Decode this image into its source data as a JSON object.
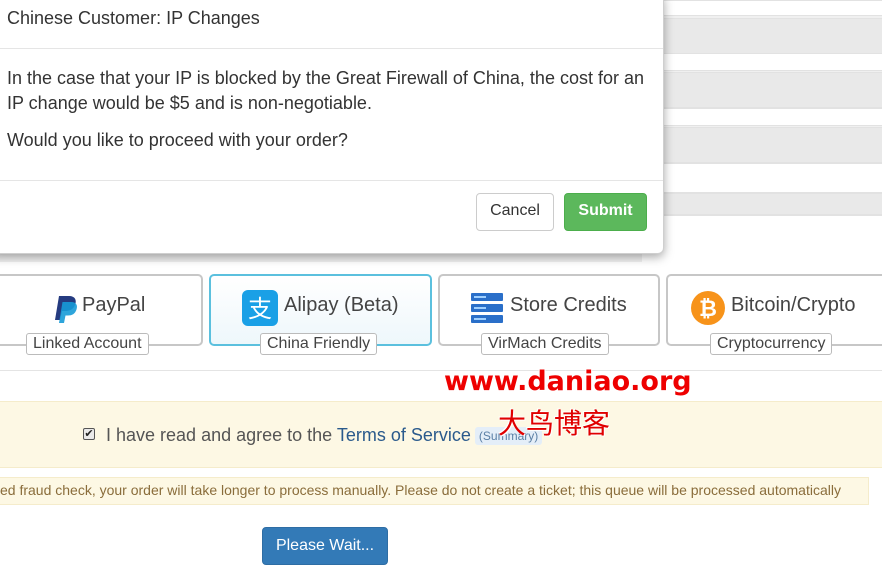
{
  "modal": {
    "title": "Chinese Customer: IP Changes",
    "body_paragraph_1": "In the case that your IP is blocked by the Great Firewall of China, the cost for an IP change would be $5 and is non-negotiable.",
    "body_paragraph_2": "Would you like to proceed with your order?",
    "cancel_label": "Cancel",
    "submit_label": "Submit"
  },
  "payment_methods": [
    {
      "name": "PayPal",
      "tag": "Linked Account",
      "icon": "paypal-icon",
      "selected": false
    },
    {
      "name": "Alipay (Beta)",
      "tag": "China Friendly",
      "icon": "alipay-icon",
      "selected": true
    },
    {
      "name": "Store Credits",
      "tag": "VirMach Credits",
      "icon": "store-credits-icon",
      "selected": false
    },
    {
      "name": "Bitcoin/Crypto",
      "tag": "Cryptocurrency",
      "icon": "bitcoin-icon",
      "selected": false
    }
  ],
  "agreement": {
    "checked": true,
    "text": "I have read and agree to the ",
    "link_text": "Terms of Service",
    "summary_label": "(Summary)"
  },
  "notice": {
    "text": "ed fraud check, your order will take longer to process manually. Please do not create a ticket; this queue will be processed automatically"
  },
  "submit_area": {
    "wait_label": "Please Wait..."
  },
  "watermark": {
    "url": "www.daniao.org",
    "name": "大鸟博客"
  },
  "colors": {
    "submit_green": "#5cb85c",
    "primary_blue": "#337ab7",
    "selected_border": "#5bc0de",
    "notice_bg": "#fdf8e4",
    "watermark_red": "#ee0000"
  }
}
